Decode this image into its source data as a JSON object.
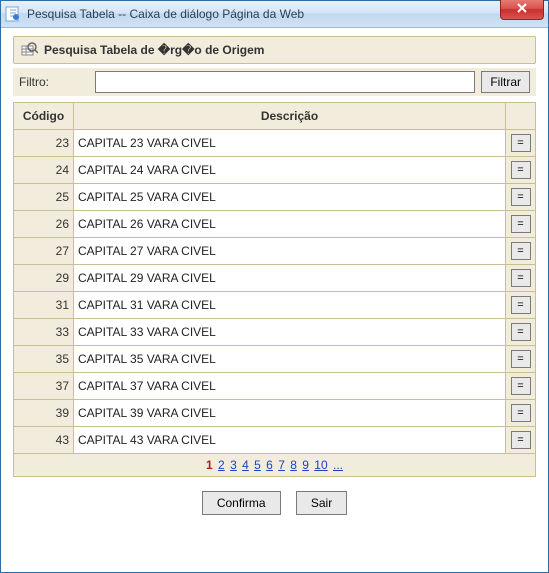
{
  "window": {
    "title": "Pesquisa Tabela -- Caixa de diálogo Página da Web"
  },
  "header": {
    "title": "Pesquisa Tabela de �rg�o de Origem"
  },
  "filter": {
    "label": "Filtro:",
    "value": "",
    "button": "Filtrar"
  },
  "columns": {
    "code": "Código",
    "desc": "Descrição"
  },
  "rows": [
    {
      "code": "23",
      "desc": "CAPITAL 23 VARA CIVEL"
    },
    {
      "code": "24",
      "desc": "CAPITAL 24 VARA CIVEL"
    },
    {
      "code": "25",
      "desc": "CAPITAL 25 VARA CIVEL"
    },
    {
      "code": "26",
      "desc": "CAPITAL 26 VARA CIVEL"
    },
    {
      "code": "27",
      "desc": "CAPITAL 27 VARA CIVEL"
    },
    {
      "code": "29",
      "desc": "CAPITAL 29 VARA CIVEL"
    },
    {
      "code": "31",
      "desc": "CAPITAL 31 VARA CIVEL"
    },
    {
      "code": "33",
      "desc": "CAPITAL 33 VARA CIVEL"
    },
    {
      "code": "35",
      "desc": "CAPITAL 35 VARA CIVEL"
    },
    {
      "code": "37",
      "desc": "CAPITAL 37 VARA CIVEL"
    },
    {
      "code": "39",
      "desc": "CAPITAL 39 VARA CIVEL"
    },
    {
      "code": "43",
      "desc": "CAPITAL 43 VARA CIVEL"
    }
  ],
  "row_button": "=",
  "pager": {
    "current": "1",
    "pages": [
      "2",
      "3",
      "4",
      "5",
      "6",
      "7",
      "8",
      "9",
      "10",
      "..."
    ]
  },
  "footer": {
    "confirm": "Confirma",
    "exit": "Sair"
  }
}
